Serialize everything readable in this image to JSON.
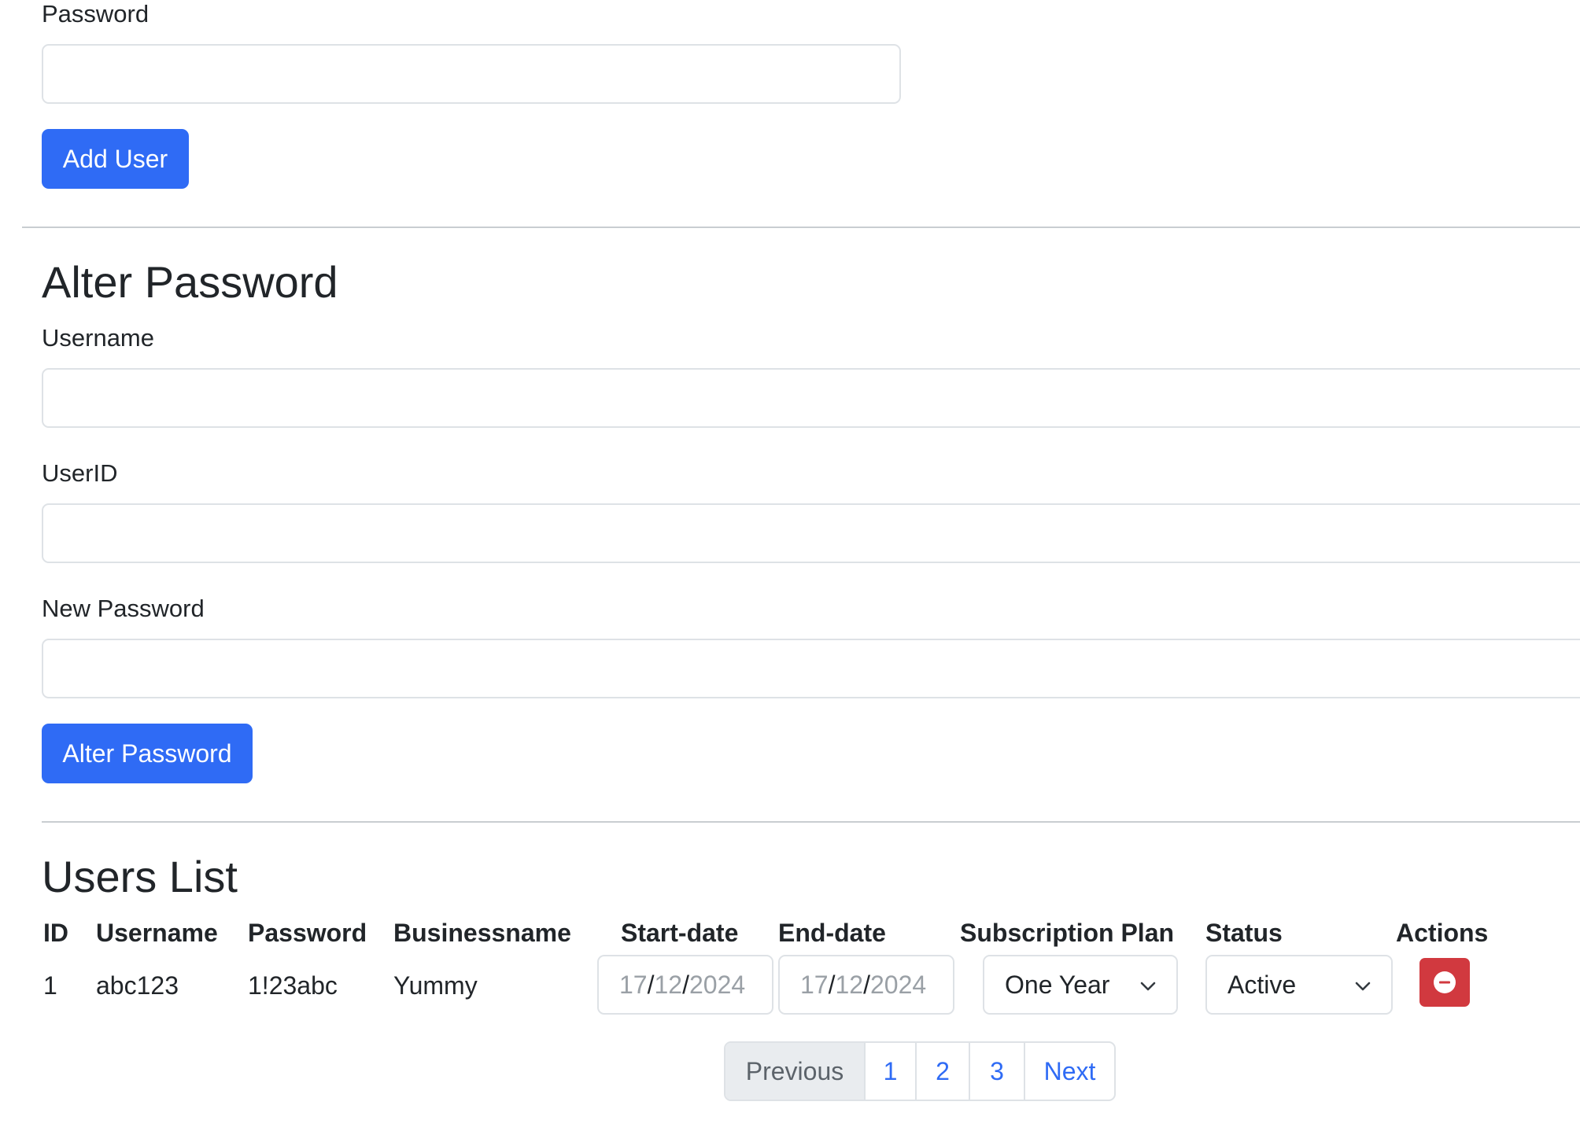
{
  "add_user_form": {
    "password_label": "Password",
    "password_value": "",
    "submit_label": "Add User"
  },
  "alter_password": {
    "title": "Alter Password",
    "username_label": "Username",
    "username_value": "",
    "userid_label": "UserID",
    "userid_value": "",
    "new_password_label": "New Password",
    "new_password_value": "",
    "submit_label": "Alter Password"
  },
  "users_list": {
    "title": "Users List",
    "columns": [
      "ID",
      "Username",
      "Password",
      "Businessname",
      "Start-date",
      "End-date",
      "Subscription Plan",
      "Status",
      "Actions"
    ],
    "rows": [
      {
        "id": "1",
        "username": "abc123",
        "password": "1!23abc",
        "businessname": "Yummy",
        "start_date": {
          "day": "17",
          "month": "12",
          "year": "2024"
        },
        "end_date": {
          "day": "17",
          "month": "12",
          "year": "2024"
        },
        "subscription_plan": "One Year",
        "status": "Active",
        "action_icon": "minus-circle-icon"
      }
    ]
  },
  "pagination": {
    "previous_label": "Previous",
    "pages": [
      "1",
      "2",
      "3"
    ],
    "next_label": "Next"
  },
  "colors": {
    "primary": "#2f6bf5",
    "danger": "#d1393f",
    "border": "#dee2e6",
    "text": "#212529"
  }
}
